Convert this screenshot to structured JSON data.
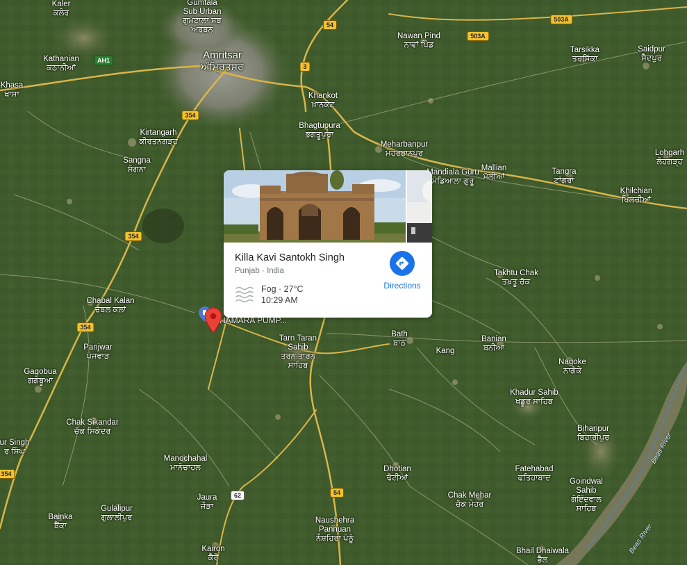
{
  "map": {
    "type": "satellite",
    "places": [
      {
        "id": "kaler",
        "en": "Kaler",
        "pa": "ਕਲੇਰ"
      },
      {
        "id": "gumtala",
        "en": "Gumtala Sub Urban",
        "pa": "ਗੁਮਟਾਲਾ ਸਬ ਅਰਬਨ"
      },
      {
        "id": "kathanian",
        "en": "Kathanian",
        "pa": "ਕਠਾਨੀਆਂ"
      },
      {
        "id": "amritsar",
        "en": "Amritsar",
        "pa": "ਅੰਮ੍ਰਿਤਸਰ"
      },
      {
        "id": "khasa",
        "en": "Khasa",
        "pa": "ਖਾਸਾ"
      },
      {
        "id": "nawan_pind",
        "en": "Nawan Pind",
        "pa": "ਨਾਵਾਂ ਪਿੰਡ"
      },
      {
        "id": "tarsikka",
        "en": "Tarsikka",
        "pa": "ਤਰਸਿੱਕਾ"
      },
      {
        "id": "saidpur",
        "en": "Saidpur",
        "pa": "ਸੈਦਪੁਰ"
      },
      {
        "id": "khankot",
        "en": "Khankot",
        "pa": "ਖ਼ਾਨਕੋਟ"
      },
      {
        "id": "kirtangarh",
        "en": "Kirtangarh",
        "pa": "ਕੀਰਤਨਗੜ੍ਹ"
      },
      {
        "id": "bhagtupura",
        "en": "Bhagtupura",
        "pa": "ਭਗਤੂਪੁਰਾ"
      },
      {
        "id": "meharbanpur",
        "en": "Meharbanpur",
        "pa": "ਮੇਹਰਬਾਨਪੁਰ"
      },
      {
        "id": "sangna",
        "en": "Sangna",
        "pa": "ਸੰਗਨਾ"
      },
      {
        "id": "lohgarh",
        "en": "Lohgarh",
        "pa": "ਲੋਹਗੜ੍ਹ"
      },
      {
        "id": "mallian",
        "en": "Mallian",
        "pa": "ਮੱਲੀਆਂ"
      },
      {
        "id": "tangra",
        "en": "Tangra",
        "pa": "ਟਾਂਗਰਾ"
      },
      {
        "id": "khilchian",
        "en": "Khilchian",
        "pa": "ਖਿਲਚੀਆਂ"
      },
      {
        "id": "takhtu_chak",
        "en": "Takhtu Chak",
        "pa": "ਤਖ਼ਤੂ ਚੱਕ"
      },
      {
        "id": "chabal_kalan",
        "en": "Chabal Kalan",
        "pa": "ਚੱਬਲ ਕਲਾਂ"
      },
      {
        "id": "tarn_taran",
        "en": "Tarn Taran Sahib",
        "pa": "ਤਰਨ ਤਾਰਨ ਸਾਹਿਬ"
      },
      {
        "id": "bath",
        "en": "Bath",
        "pa": "ਬਾਠ"
      },
      {
        "id": "banian",
        "en": "Banian",
        "pa": "ਬਨੀਆ"
      },
      {
        "id": "kang",
        "en": "Kang",
        "pa": ""
      },
      {
        "id": "panjwar",
        "en": "Panjwar",
        "pa": "ਪੰਜਵਾੜ"
      },
      {
        "id": "gagobua",
        "en": "Gagobua",
        "pa": "ਗਗੋਬੂਆ"
      },
      {
        "id": "nagoke",
        "en": "Nagoke",
        "pa": "ਨਾਗੋਕੇ"
      },
      {
        "id": "khadur_sahib",
        "en": "Khadur Sahib",
        "pa": "ਖਡੂਰ ਸਾਹਿਬ"
      },
      {
        "id": "chak_sikandar",
        "en": "Chak Sikandar",
        "pa": "ਚੱਕ ਸਿਕੰਦਰ"
      },
      {
        "id": "biharipur",
        "en": "Biharipur",
        "pa": "ਬਿਹਾਰੀਪੁਰ"
      },
      {
        "id": "ur_singh",
        "en": "ur Singh",
        "pa": "ਰ ਸਿੰਘ"
      },
      {
        "id": "manochahal",
        "en": "Manochahal",
        "pa": "ਮਾਨੋਚਾਹਲ"
      },
      {
        "id": "dhotian",
        "en": "Dhotian",
        "pa": "ਢੋਟੀਆਂ"
      },
      {
        "id": "fatehabad",
        "en": "Fatehabad",
        "pa": "ਫਤਿਹਾਬਾਦ"
      },
      {
        "id": "goindwal",
        "en": "Goindwal Sahib",
        "pa": "ਗੋਇੰਦਵਾਲ ਸਾਹਿਬ"
      },
      {
        "id": "chak_mehar",
        "en": "Chak Mehar",
        "pa": "ਚੱਕ ਮੇਹਰ"
      },
      {
        "id": "jaura",
        "en": "Jaura",
        "pa": "ਜੌੜਾ"
      },
      {
        "id": "gulalipur",
        "en": "Gulalipur",
        "pa": "ਗੁਲਾਲੀਪੁਰ"
      },
      {
        "id": "bainka",
        "en": "Bainka",
        "pa": "ਬੈਂਕਾ"
      },
      {
        "id": "naushehra",
        "en": "Naushehra Pannuan",
        "pa": "ਨੌਸ਼ਹਿਰਾ ਪੰਨੂੰ"
      },
      {
        "id": "kairon",
        "en": "Kairon",
        "pa": "ਕੈਰੋਂ"
      },
      {
        "id": "bhail_dhaiwala",
        "en": "Bhail Dhaiwala",
        "pa": "ਭੈਲ"
      },
      {
        "id": "mandiala",
        "en": "Mandiala Guru",
        "pa": "ਮੰਡਿਆਲਾ ਗੁਰੂ"
      }
    ],
    "roads": [
      {
        "id": "ah1",
        "label": "AH1",
        "style": "green"
      },
      {
        "id": "r354a",
        "label": "354",
        "style": "yellow"
      },
      {
        "id": "r354b",
        "label": "354",
        "style": "yellow"
      },
      {
        "id": "r354c",
        "label": "354",
        "style": "yellow"
      },
      {
        "id": "r354d",
        "label": "354",
        "style": "yellow"
      },
      {
        "id": "r54a",
        "label": "54",
        "style": "yellow"
      },
      {
        "id": "r54b",
        "label": "54",
        "style": "yellow"
      },
      {
        "id": "r3",
        "label": "3",
        "style": "yellow"
      },
      {
        "id": "r503a1",
        "label": "503A",
        "style": "yellow"
      },
      {
        "id": "r503a2",
        "label": "503A",
        "style": "yellow"
      },
      {
        "id": "r62",
        "label": "62",
        "style": "white"
      }
    ],
    "rivers": [
      {
        "id": "beas1",
        "label": "Beas River"
      },
      {
        "id": "beas2",
        "label": "Beas River"
      }
    ],
    "poi": {
      "label": "HAMARA PUMP..."
    }
  },
  "place_card": {
    "title": "Killa Kavi Santokh Singh",
    "region": "Punjab",
    "country": "India",
    "separator": "·",
    "weather_condition": "Fog",
    "temperature": "27°C",
    "weather_line": "Fog · 27°C",
    "time": "10:29 AM",
    "directions_label": "Directions"
  }
}
